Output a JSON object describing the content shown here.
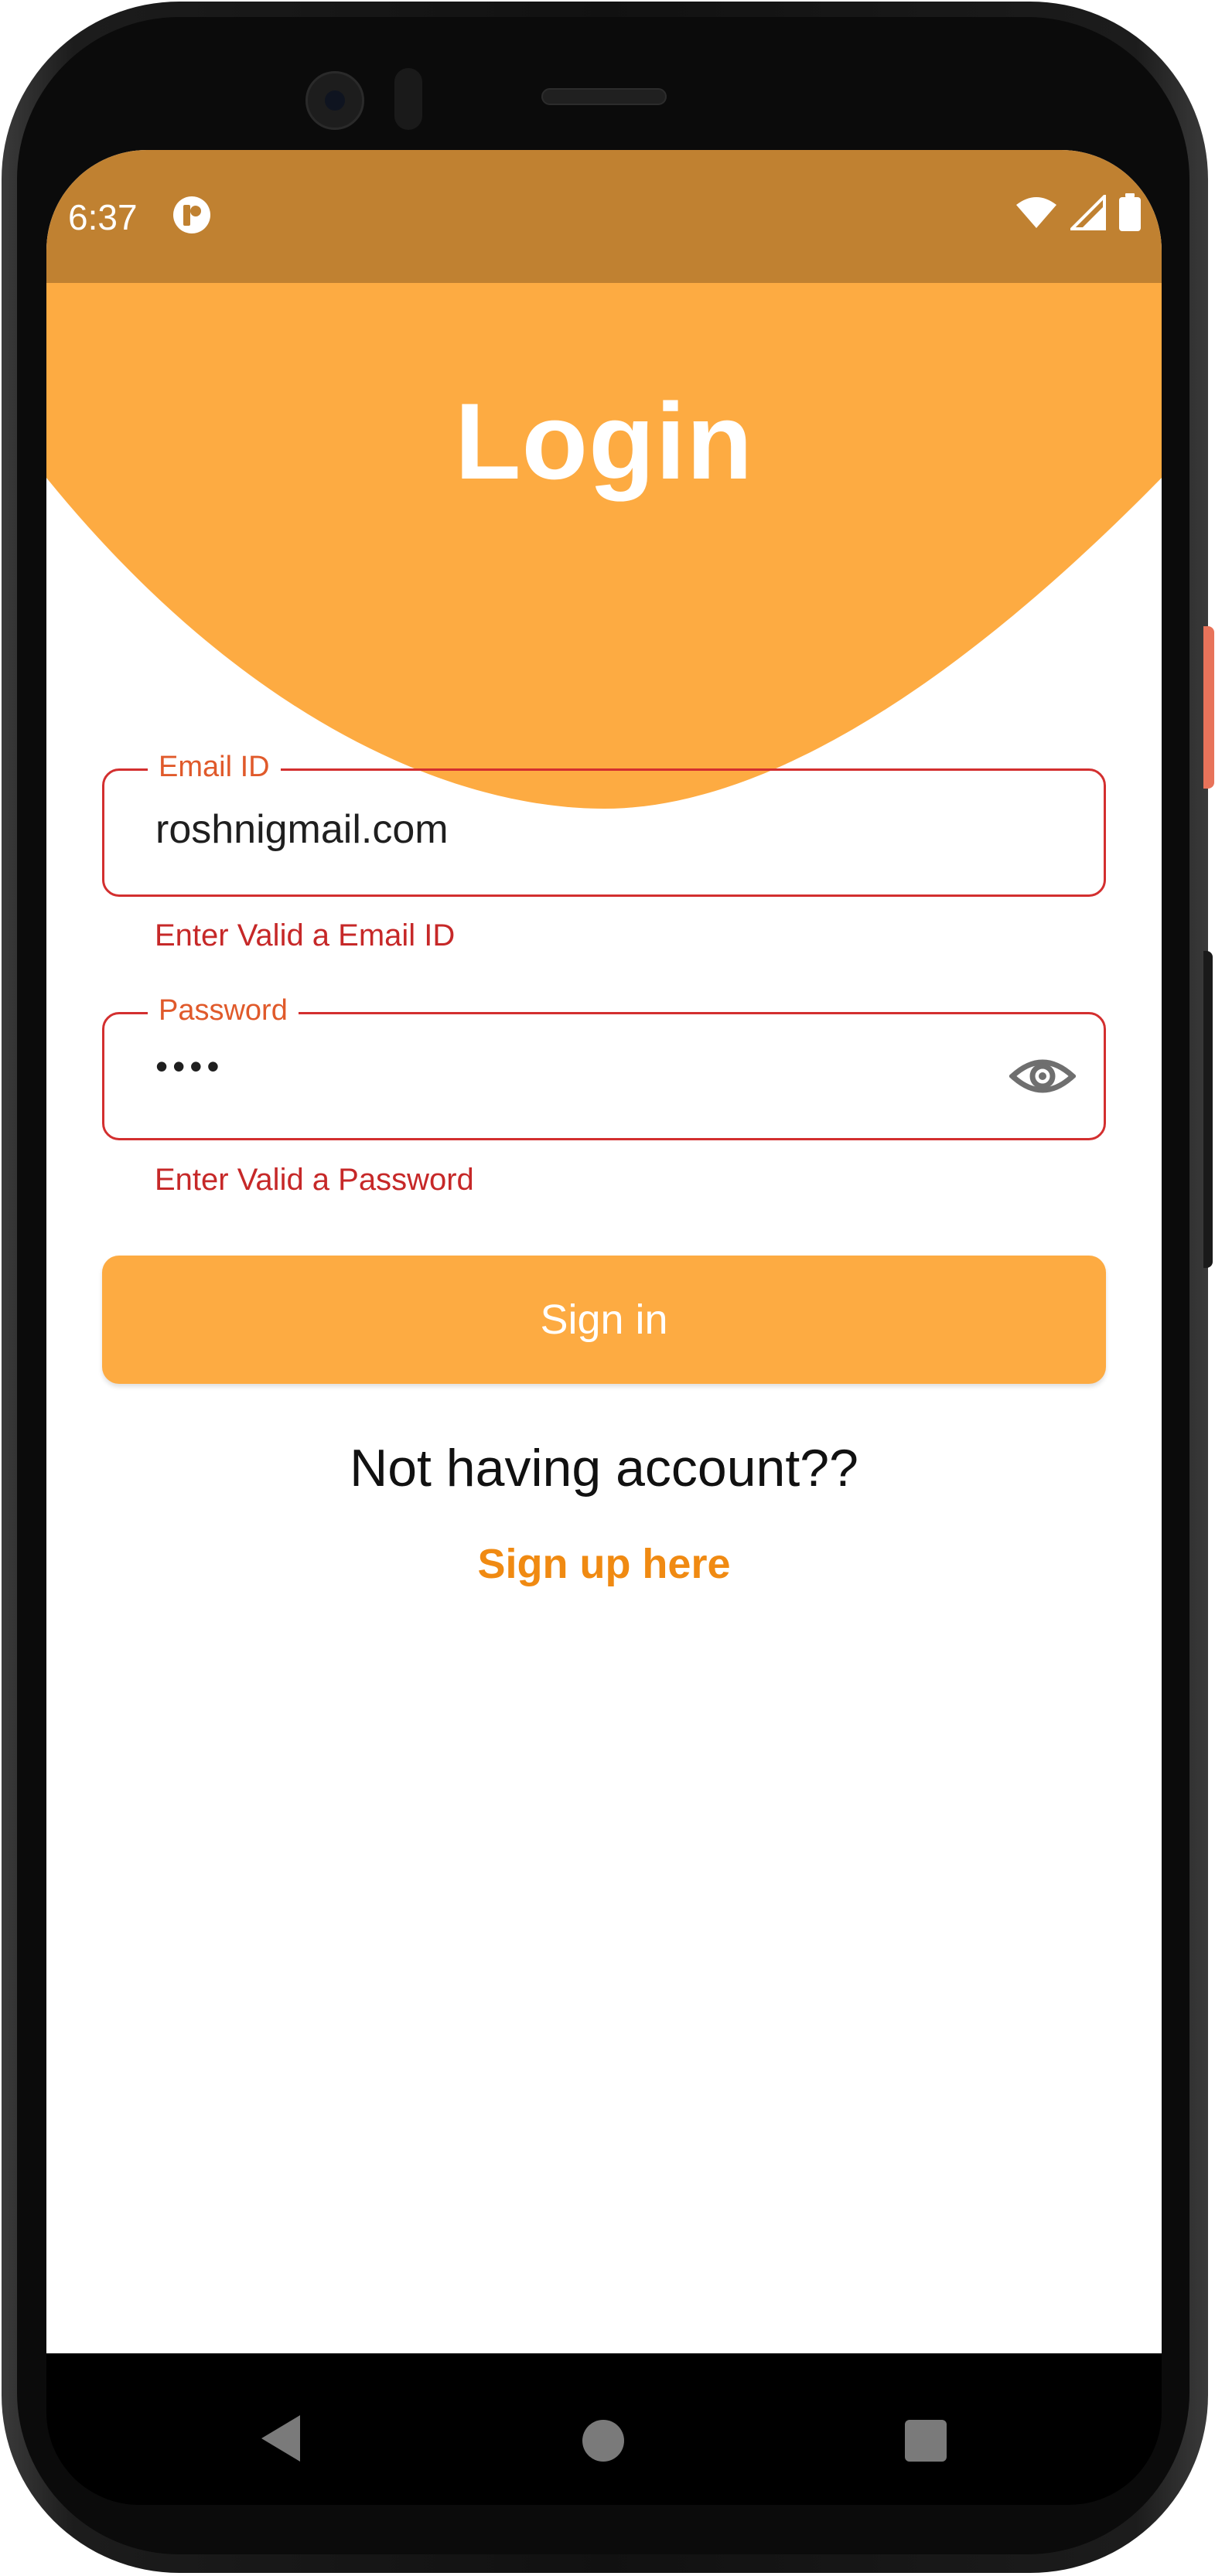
{
  "status_bar": {
    "time": "6:37",
    "background_color": "#c08131",
    "icons": [
      "app-notification-icon",
      "wifi-icon",
      "signal-icon",
      "battery-icon"
    ]
  },
  "header": {
    "title": "Login",
    "background_color": "#fdab42"
  },
  "email_field": {
    "label": "Email ID",
    "value": "roshnigmail.com",
    "error": "Enter Valid a Email ID"
  },
  "password_field": {
    "label": "Password",
    "value": "••••",
    "error": "Enter Valid a Password",
    "toggle_icon": "eye-icon"
  },
  "signin_button": {
    "label": "Sign in",
    "color": "#fdab42"
  },
  "footer": {
    "prompt": "Not having account??",
    "signup_link": "Sign up here",
    "link_color": "#f08a12"
  },
  "error_color": "#d32f2f",
  "nav_bar": {
    "icons": [
      "back-icon",
      "home-icon",
      "recents-icon"
    ]
  }
}
